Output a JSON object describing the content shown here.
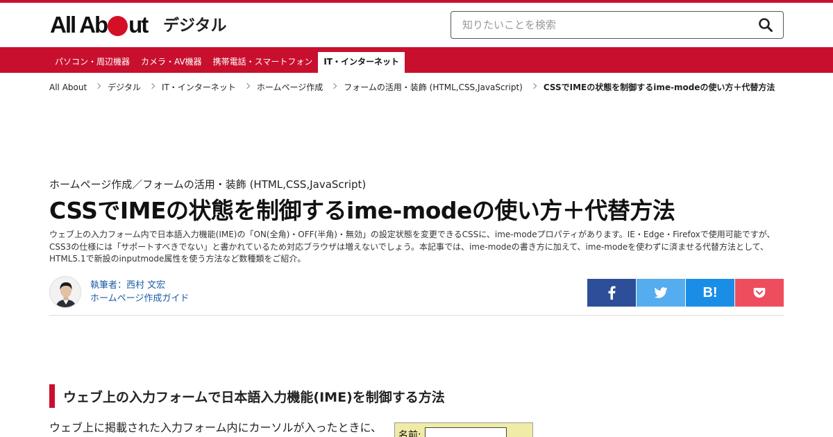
{
  "header": {
    "logo_left": "All Ab",
    "logo_right": "ut",
    "site_name": "デジタル",
    "search_placeholder": "知りたいことを検索"
  },
  "nav": {
    "items": [
      {
        "label": "パソコン・周辺機器"
      },
      {
        "label": "カメラ・AV機器"
      },
      {
        "label": "携帯電話・スマートフォン"
      },
      {
        "label": "IT・インターネット",
        "active": true
      }
    ]
  },
  "breadcrumb": [
    {
      "label": "All About"
    },
    {
      "label": "デジタル"
    },
    {
      "label": "IT・インターネット"
    },
    {
      "label": "ホームページ作成"
    },
    {
      "label": "フォームの活用・装飾 (HTML,CSS,JavaScript)"
    },
    {
      "label": "CSSでIMEの状態を制御するime-modeの使い方＋代替方法"
    }
  ],
  "article": {
    "category": "ホームページ作成／フォームの活用・装飾 (HTML,CSS,JavaScript)",
    "title": "CSSでIMEの状態を制御するime-modeの使い方＋代替方法",
    "lead": "ウェブ上の入力フォーム内で日本語入力機能(IME)の「ON(全角)・OFF(半角)・無効」の設定状態を変更できるCSSに、ime-modeプロパティがあります。IE・Edge・Firefoxで使用可能ですが、CSS3の仕様には「サポートすべきでない」と書かれているため対応ブラウザは増えないでしょう。本記事では、ime-modeの書き方に加えて、ime-modeを使わずに済ませる代替方法として、HTML5.1で新設のinputmode属性を使う方法など数種類をご紹介。"
  },
  "author": {
    "name": "執筆者：西村 文宏",
    "role": "ホームページ作成ガイド"
  },
  "share": {
    "hatena_label": "B!"
  },
  "section": {
    "heading": "ウェブ上の入力フォームで日本語入力機能(IME)を制御する方法",
    "body": "ウェブ上に掲載された入力フォーム内にカーソルが入ったときに、"
  },
  "form_sample": {
    "label": "名前:"
  },
  "colors": {
    "brand_red": "#c8102e",
    "facebook": "#2d4f99",
    "twitter": "#55acee",
    "hatena": "#1a8ee6",
    "pocket": "#ee4d5e",
    "link": "#1a5aa6"
  }
}
